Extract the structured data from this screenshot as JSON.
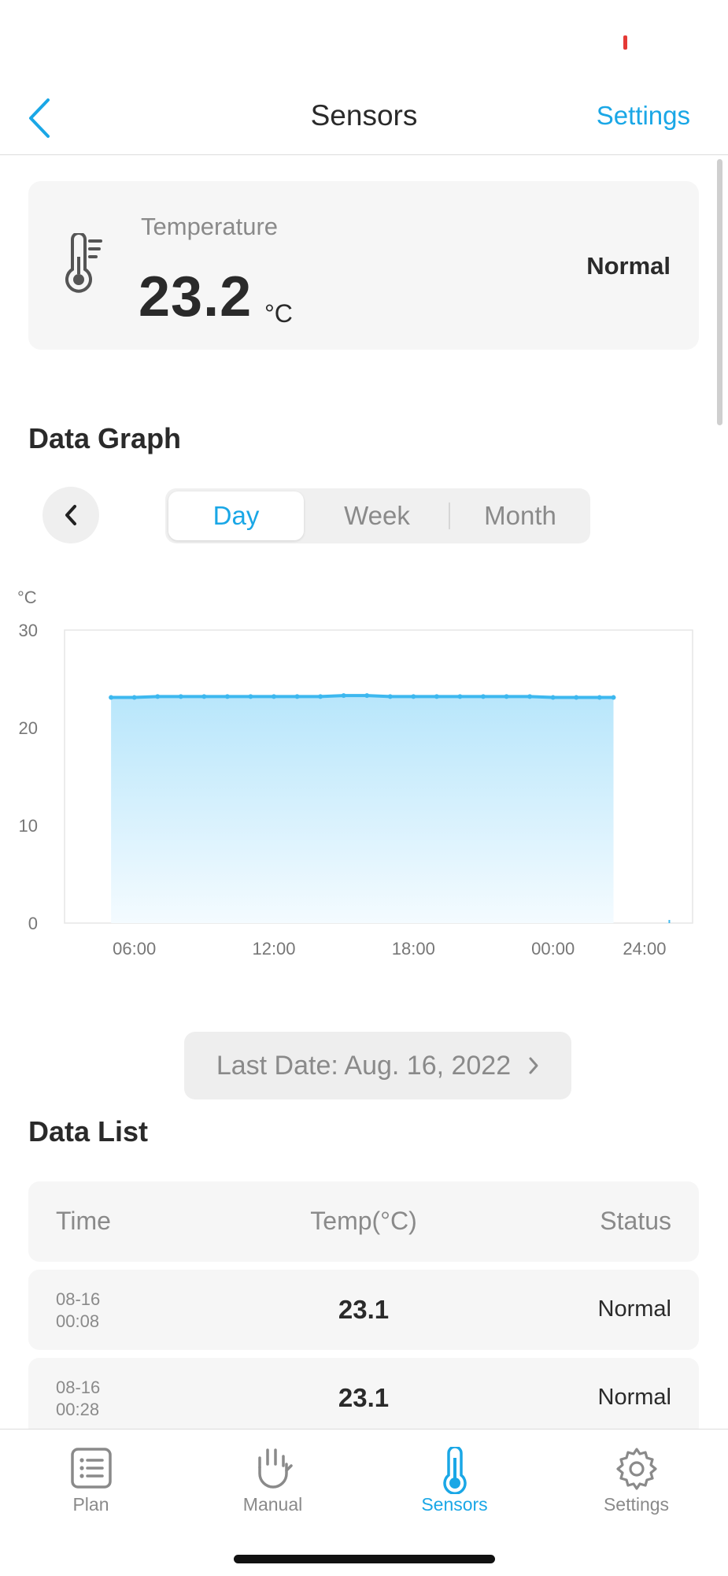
{
  "header": {
    "title": "Sensors",
    "settings_label": "Settings"
  },
  "sensor": {
    "label": "Temperature",
    "value": "23.2",
    "unit": "°C",
    "status": "Normal"
  },
  "graph": {
    "section_title": "Data Graph",
    "tabs": [
      {
        "label": "Day",
        "active": true
      },
      {
        "label": "Week",
        "active": false
      },
      {
        "label": "Month",
        "active": false
      }
    ]
  },
  "chart_data": {
    "type": "area",
    "ylabel": "°C",
    "ylim": [
      0,
      30
    ],
    "yticks": [
      "0",
      "10",
      "20",
      "30"
    ],
    "xticks": [
      "06:00",
      "12:00",
      "18:00",
      "00:00",
      "24:00"
    ],
    "series": [
      {
        "x": [
          5,
          6,
          7,
          8,
          9,
          10,
          11,
          12,
          13,
          14,
          15,
          16,
          17,
          18,
          19,
          20,
          21,
          22,
          23,
          24,
          25,
          26,
          26.6
        ],
        "values": [
          23.1,
          23.1,
          23.2,
          23.2,
          23.2,
          23.2,
          23.2,
          23.2,
          23.2,
          23.2,
          23.3,
          23.3,
          23.2,
          23.2,
          23.2,
          23.2,
          23.2,
          23.2,
          23.2,
          23.1,
          23.1,
          23.1,
          23.1
        ]
      }
    ],
    "color": "#3db8ef"
  },
  "last_date": "Last Date: Aug. 16, 2022",
  "list": {
    "section_title": "Data List",
    "headers": {
      "time": "Time",
      "temp": "Temp(°C)",
      "status": "Status"
    },
    "rows": [
      {
        "date": "08-16",
        "time": "00:08",
        "temp": "23.1",
        "status": "Normal"
      },
      {
        "date": "08-16",
        "time": "00:28",
        "temp": "23.1",
        "status": "Normal"
      }
    ]
  },
  "tabbar": {
    "items": [
      {
        "label": "Plan",
        "icon": "plan-icon"
      },
      {
        "label": "Manual",
        "icon": "hand-icon"
      },
      {
        "label": "Sensors",
        "icon": "thermometer-icon",
        "active": true
      },
      {
        "label": "Settings",
        "icon": "gear-icon"
      }
    ]
  },
  "colors": {
    "accent": "#1aa7e6",
    "card": "#f6f6f6",
    "alert": "#e53935"
  }
}
